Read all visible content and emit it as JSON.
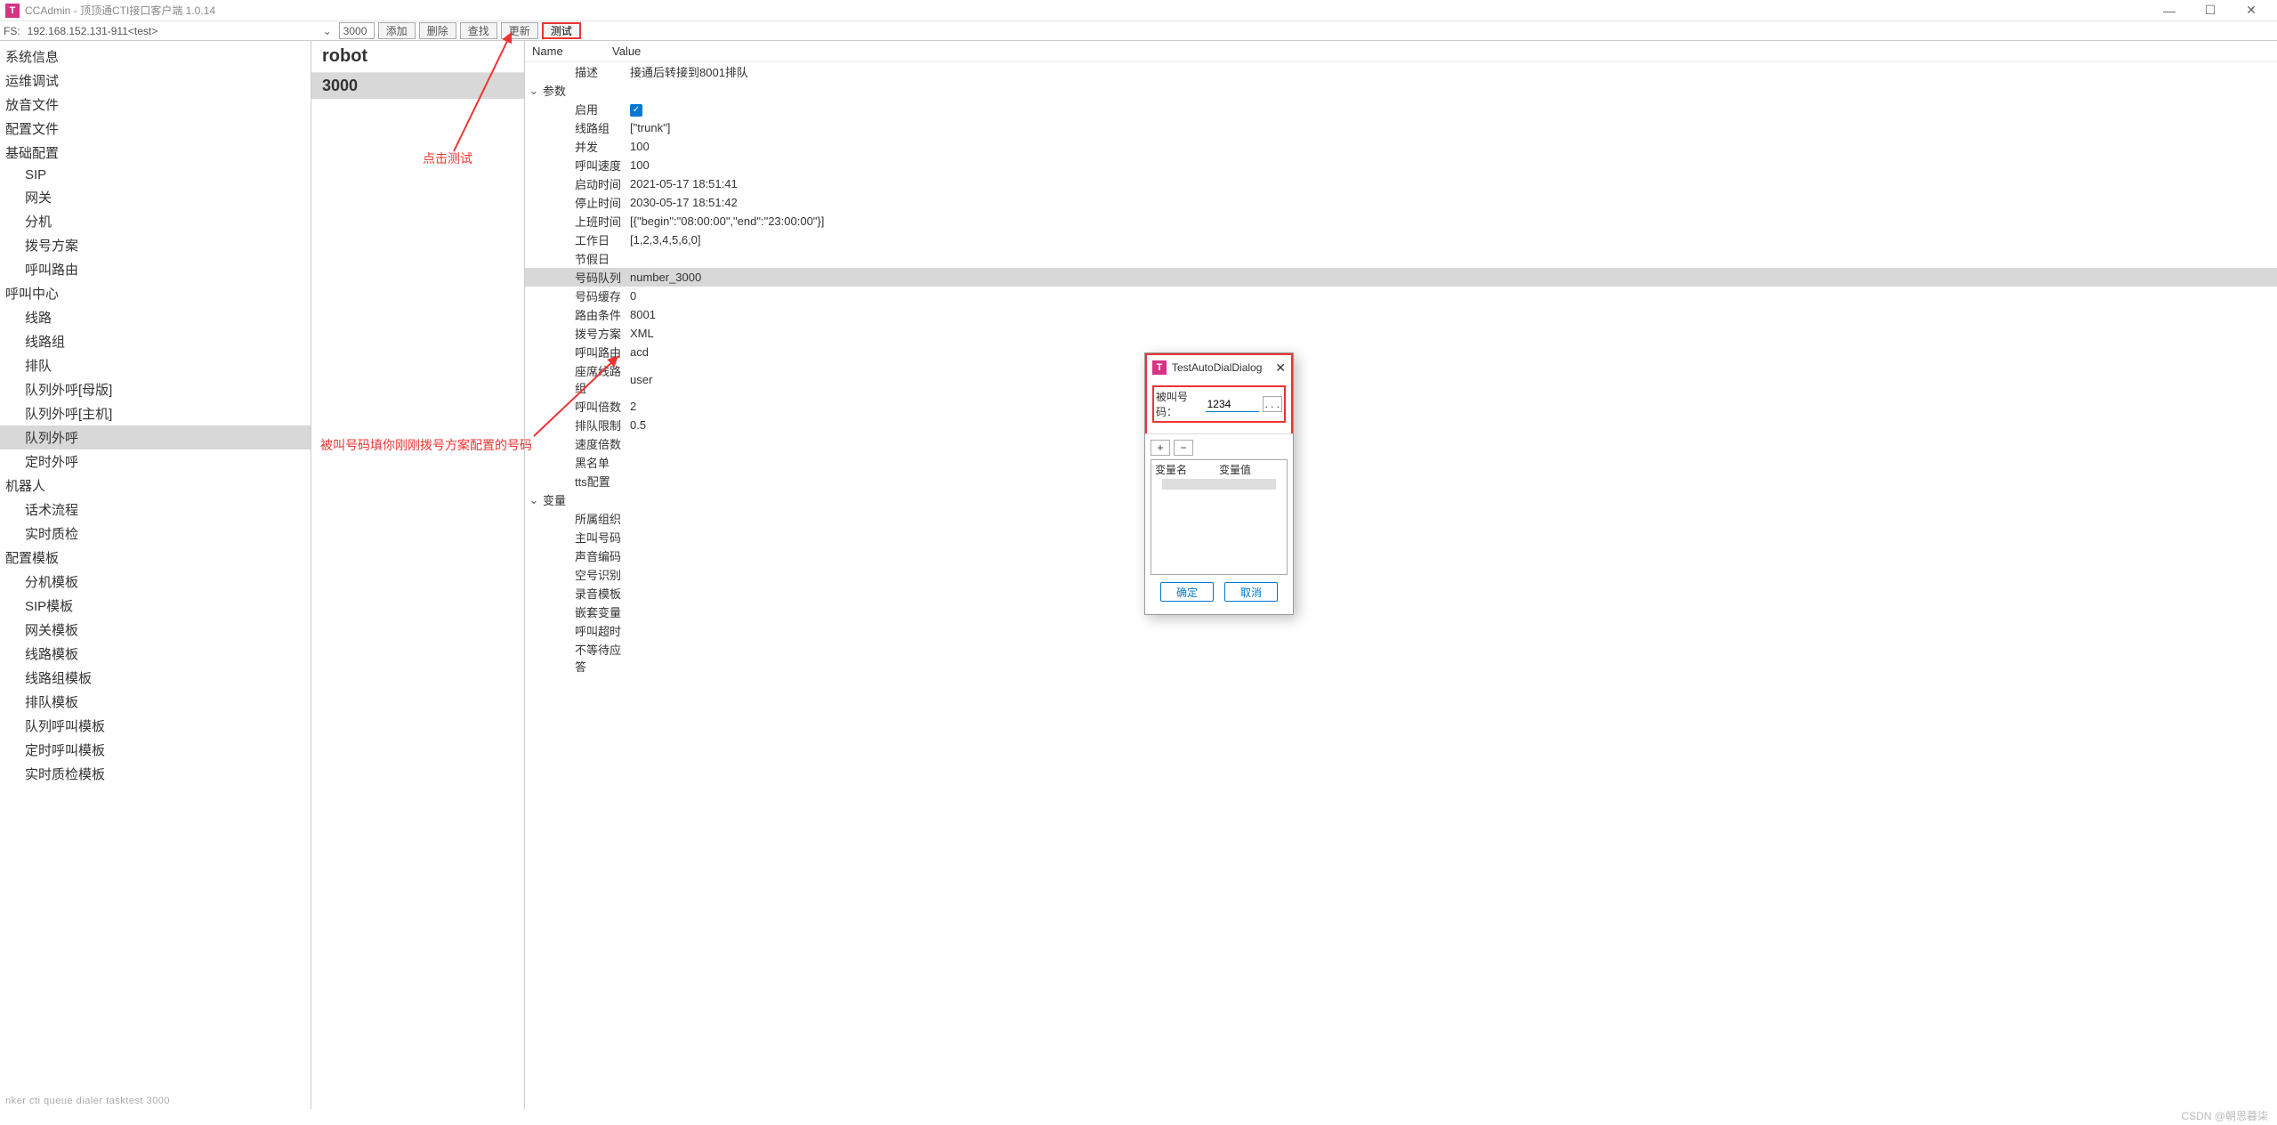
{
  "window": {
    "icon_letter": "T",
    "title": "CCAdmin - 顶顶通CTI接口客户端 1.0.14",
    "min": "—",
    "max": "☐",
    "close": "✕"
  },
  "fsbar": {
    "label": "FS:",
    "address": "192.168.152.131-911<test>",
    "chev": "⌄",
    "numbox": "3000",
    "buttons": {
      "add": "添加",
      "del": "删除",
      "find": "查找",
      "refresh": "更新",
      "test": "测试"
    }
  },
  "sidebar": [
    {
      "label": "系统信息",
      "sub": false
    },
    {
      "label": "运维调试",
      "sub": false
    },
    {
      "label": "放音文件",
      "sub": false
    },
    {
      "label": "配置文件",
      "sub": false
    },
    {
      "label": "基础配置",
      "sub": false
    },
    {
      "label": "SIP",
      "sub": true
    },
    {
      "label": "网关",
      "sub": true
    },
    {
      "label": "分机",
      "sub": true
    },
    {
      "label": "拨号方案",
      "sub": true
    },
    {
      "label": "呼叫路由",
      "sub": true
    },
    {
      "label": "呼叫中心",
      "sub": false
    },
    {
      "label": "线路",
      "sub": true
    },
    {
      "label": "线路组",
      "sub": true
    },
    {
      "label": "排队",
      "sub": true
    },
    {
      "label": "队列外呼[母版]",
      "sub": true
    },
    {
      "label": "队列外呼[主机]",
      "sub": true
    },
    {
      "label": "队列外呼",
      "sub": true,
      "selected": true
    },
    {
      "label": "定时外呼",
      "sub": true
    },
    {
      "label": "机器人",
      "sub": false
    },
    {
      "label": "话术流程",
      "sub": true
    },
    {
      "label": "实时质检",
      "sub": true
    },
    {
      "label": "配置模板",
      "sub": false
    },
    {
      "label": "分机模板",
      "sub": true
    },
    {
      "label": "SIP模板",
      "sub": true
    },
    {
      "label": "网关模板",
      "sub": true
    },
    {
      "label": "线路模板",
      "sub": true
    },
    {
      "label": "线路组模板",
      "sub": true
    },
    {
      "label": "排队模板",
      "sub": true
    },
    {
      "label": "队列呼叫模板",
      "sub": true
    },
    {
      "label": "定时呼叫模板",
      "sub": true
    },
    {
      "label": "实时质检模板",
      "sub": true
    }
  ],
  "mid": {
    "head": "robot",
    "row": "3000"
  },
  "props": {
    "head_name": "Name",
    "head_value": "Value",
    "desc_n": "描述",
    "desc_v": "接通后转接到8001排队",
    "params_n": "参数",
    "rows": [
      {
        "n": "启用",
        "v": "__check__"
      },
      {
        "n": "线路组",
        "v": "[\"trunk\"]"
      },
      {
        "n": "并发",
        "v": "100"
      },
      {
        "n": "呼叫速度",
        "v": "100"
      },
      {
        "n": "启动时间",
        "v": "2021-05-17 18:51:41"
      },
      {
        "n": "停止时间",
        "v": "2030-05-17 18:51:42"
      },
      {
        "n": "上班时间",
        "v": "[{\"begin\":\"08:00:00\",\"end\":\"23:00:00\"}]"
      },
      {
        "n": "工作日",
        "v": "[1,2,3,4,5,6,0]"
      },
      {
        "n": "节假日",
        "v": ""
      },
      {
        "n": "号码队列",
        "v": "number_3000",
        "sel": true
      },
      {
        "n": "号码缓存",
        "v": "0"
      },
      {
        "n": "路由条件",
        "v": "8001"
      },
      {
        "n": "拨号方案",
        "v": "XML"
      },
      {
        "n": "呼叫路由",
        "v": "acd"
      },
      {
        "n": "座席线路组",
        "v": "user"
      },
      {
        "n": "呼叫倍数",
        "v": "2"
      },
      {
        "n": "排队限制",
        "v": "0.5"
      },
      {
        "n": "速度倍数",
        "v": ""
      },
      {
        "n": "黑名单",
        "v": ""
      },
      {
        "n": "tts配置",
        "v": ""
      }
    ],
    "vars_n": "变量",
    "vars_rows": [
      {
        "n": "所属组织",
        "v": ""
      },
      {
        "n": "主叫号码",
        "v": ""
      },
      {
        "n": "声音编码",
        "v": ""
      },
      {
        "n": "空号识别",
        "v": ""
      },
      {
        "n": "录音模板",
        "v": ""
      },
      {
        "n": "嵌套变量",
        "v": ""
      },
      {
        "n": "呼叫超时",
        "v": ""
      },
      {
        "n": "不等待应答",
        "v": ""
      }
    ]
  },
  "dialog": {
    "icon_letter": "T",
    "title": "TestAutoDialDialog",
    "close": "✕",
    "label": "被叫号码：",
    "value": "1234",
    "dots": ". . .",
    "plus": "+",
    "minus": "−",
    "col1": "变量名",
    "col2": "变量值",
    "ok": "确定",
    "cancel": "取消"
  },
  "annotations": {
    "a1": "点击测试",
    "a2": "被叫号码填你刚刚拨号方案配置的号码"
  },
  "status": "nker cti queue dialer tasktest 3000",
  "watermark": "CSDN @朝思暮柒"
}
